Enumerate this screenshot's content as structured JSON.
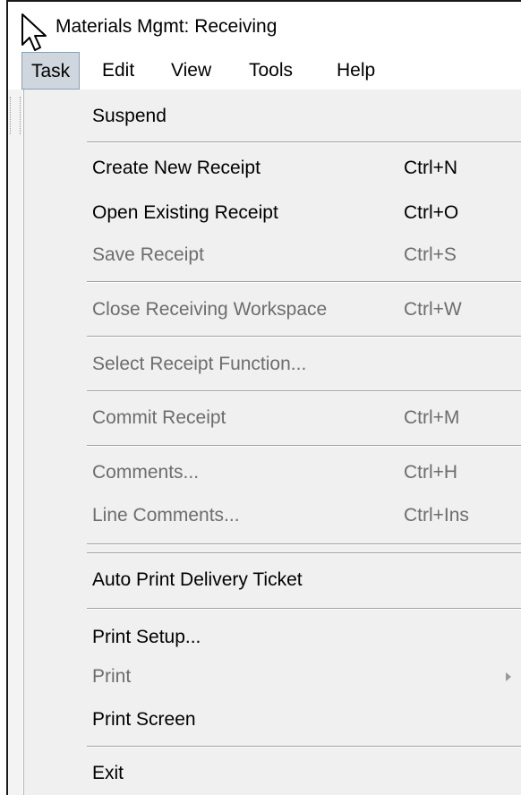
{
  "window": {
    "title": "Materials Mgmt: Receiving",
    "cursor_icon": "arrow-cursor-icon"
  },
  "menubar": {
    "items": [
      {
        "label": "Task",
        "active": true
      },
      {
        "label": "Edit"
      },
      {
        "label": "View"
      },
      {
        "label": "Tools"
      },
      {
        "label": "Help"
      }
    ]
  },
  "task_menu": {
    "items": [
      {
        "label": "Suspend",
        "shortcut": "",
        "enabled": true
      },
      {
        "label": "Create New Receipt",
        "shortcut": "Ctrl+N",
        "enabled": true
      },
      {
        "label": "Open Existing Receipt",
        "shortcut": "Ctrl+O",
        "enabled": true
      },
      {
        "label": "Save Receipt",
        "shortcut": "Ctrl+S",
        "enabled": false
      },
      {
        "label": "Close Receiving Workspace",
        "shortcut": "Ctrl+W",
        "enabled": false
      },
      {
        "label": "Select Receipt Function...",
        "shortcut": "",
        "enabled": false
      },
      {
        "label": "Commit Receipt",
        "shortcut": "Ctrl+M",
        "enabled": false
      },
      {
        "label": "Comments...",
        "shortcut": "Ctrl+H",
        "enabled": false
      },
      {
        "label": "Line Comments...",
        "shortcut": "Ctrl+Ins",
        "enabled": false
      },
      {
        "label": "Auto Print Delivery Ticket",
        "shortcut": "",
        "enabled": true
      },
      {
        "label": "Print Setup...",
        "shortcut": "",
        "enabled": true
      },
      {
        "label": "Print",
        "shortcut": "",
        "enabled": false,
        "submenu": true
      },
      {
        "label": "Print Screen",
        "shortcut": "",
        "enabled": true
      },
      {
        "label": "Exit",
        "shortcut": "",
        "enabled": true
      }
    ]
  }
}
